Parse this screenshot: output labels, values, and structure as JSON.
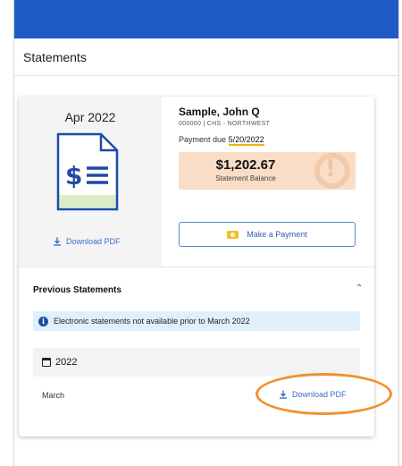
{
  "page": {
    "title": "Statements"
  },
  "current_statement": {
    "month": "Apr 2022",
    "download_label": "Download PDF",
    "account_name": "Sample, John Q",
    "account_sub": "000000 | CHS - NORTHWEST",
    "payment_due_label": "Payment due",
    "payment_due_date": "5/20/2022",
    "balance_amount": "$1,202.67",
    "balance_label": "Statement Balance",
    "pay_button_label": "Make a Payment"
  },
  "previous": {
    "header": "Previous Statements",
    "info_text": "Electronic statements not available prior to March 2022",
    "years": [
      {
        "year": "2022",
        "rows": [
          {
            "month": "March",
            "download_label": "Download PDF"
          }
        ]
      }
    ]
  },
  "colors": {
    "top_bar": "#1e5bc6",
    "link_blue": "#3a6ec8",
    "balance_bg": "#f9ddc6",
    "highlight_ring": "#f0922e",
    "info_bg": "#dff0fb"
  },
  "icons": {
    "document": "statement-document-icon",
    "download": "download-icon",
    "warning": "exclamation-icon",
    "payment": "credit-card-icon",
    "info": "info-icon",
    "calendar": "calendar-icon",
    "collapse": "chevron-up-icon"
  }
}
